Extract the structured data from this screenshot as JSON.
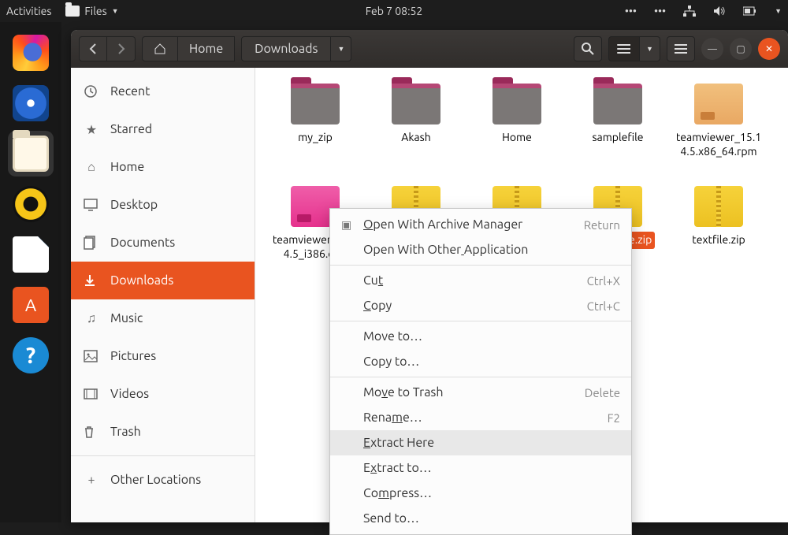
{
  "panel": {
    "activities": "Activities",
    "app_menu": "Files",
    "clock": "Feb 7  08:52"
  },
  "dock": {
    "items": [
      "firefox",
      "thunderbird",
      "files",
      "rhythmbox",
      "libreoffice",
      "software",
      "help"
    ]
  },
  "headerbar": {
    "home_label": "Home",
    "path_current": "Downloads"
  },
  "sidebar": {
    "items": [
      {
        "icon": "clock",
        "label": "Recent"
      },
      {
        "icon": "star",
        "label": "Starred"
      },
      {
        "icon": "home",
        "label": "Home"
      },
      {
        "icon": "desktop",
        "label": "Desktop"
      },
      {
        "icon": "documents",
        "label": "Documents"
      },
      {
        "icon": "downloads",
        "label": "Downloads",
        "active": true
      },
      {
        "icon": "music",
        "label": "Music"
      },
      {
        "icon": "pictures",
        "label": "Pictures"
      },
      {
        "icon": "videos",
        "label": "Videos"
      },
      {
        "icon": "trash",
        "label": "Trash"
      },
      {
        "icon": "plus",
        "label": "Other Locations"
      }
    ]
  },
  "files": {
    "row1": [
      {
        "type": "folder",
        "label": "my_zip"
      },
      {
        "type": "folder",
        "label": "Akash"
      },
      {
        "type": "folder",
        "label": "Home"
      },
      {
        "type": "folder",
        "label": "samplefile"
      },
      {
        "type": "rpm",
        "label": "teamviewer_15.14.5.x86_64.rpm"
      }
    ],
    "row2": [
      {
        "type": "deb",
        "label": "teamviewer_15.14.5_i386.deb"
      },
      {
        "type": "zip",
        "label": ""
      },
      {
        "type": "zip",
        "label": ""
      },
      {
        "type": "zip",
        "label": "samplefile.zip",
        "selected": true
      },
      {
        "type": "zip",
        "label": "textfile.zip"
      }
    ]
  },
  "context_menu": {
    "items": [
      {
        "label": "Open With Archive Manager",
        "shortcut": "Return",
        "icon": true,
        "u": 0
      },
      {
        "label": "Open With Other Application",
        "u": 15
      },
      {
        "sep": true
      },
      {
        "label": "Cut",
        "shortcut": "Ctrl+X",
        "u": 2
      },
      {
        "label": "Copy",
        "shortcut": "Ctrl+C",
        "u": 0
      },
      {
        "sep": true
      },
      {
        "label": "Move to…"
      },
      {
        "label": "Copy to…"
      },
      {
        "sep": true
      },
      {
        "label": "Move to Trash",
        "shortcut": "Delete",
        "u": 2
      },
      {
        "label": "Rename…",
        "shortcut": "F2",
        "u": 4
      },
      {
        "label": "Extract Here",
        "hover": true,
        "u": 0
      },
      {
        "label": "Extract to…",
        "u": 1
      },
      {
        "label": "Compress…",
        "u": 2
      },
      {
        "label": "Send to…"
      }
    ]
  }
}
